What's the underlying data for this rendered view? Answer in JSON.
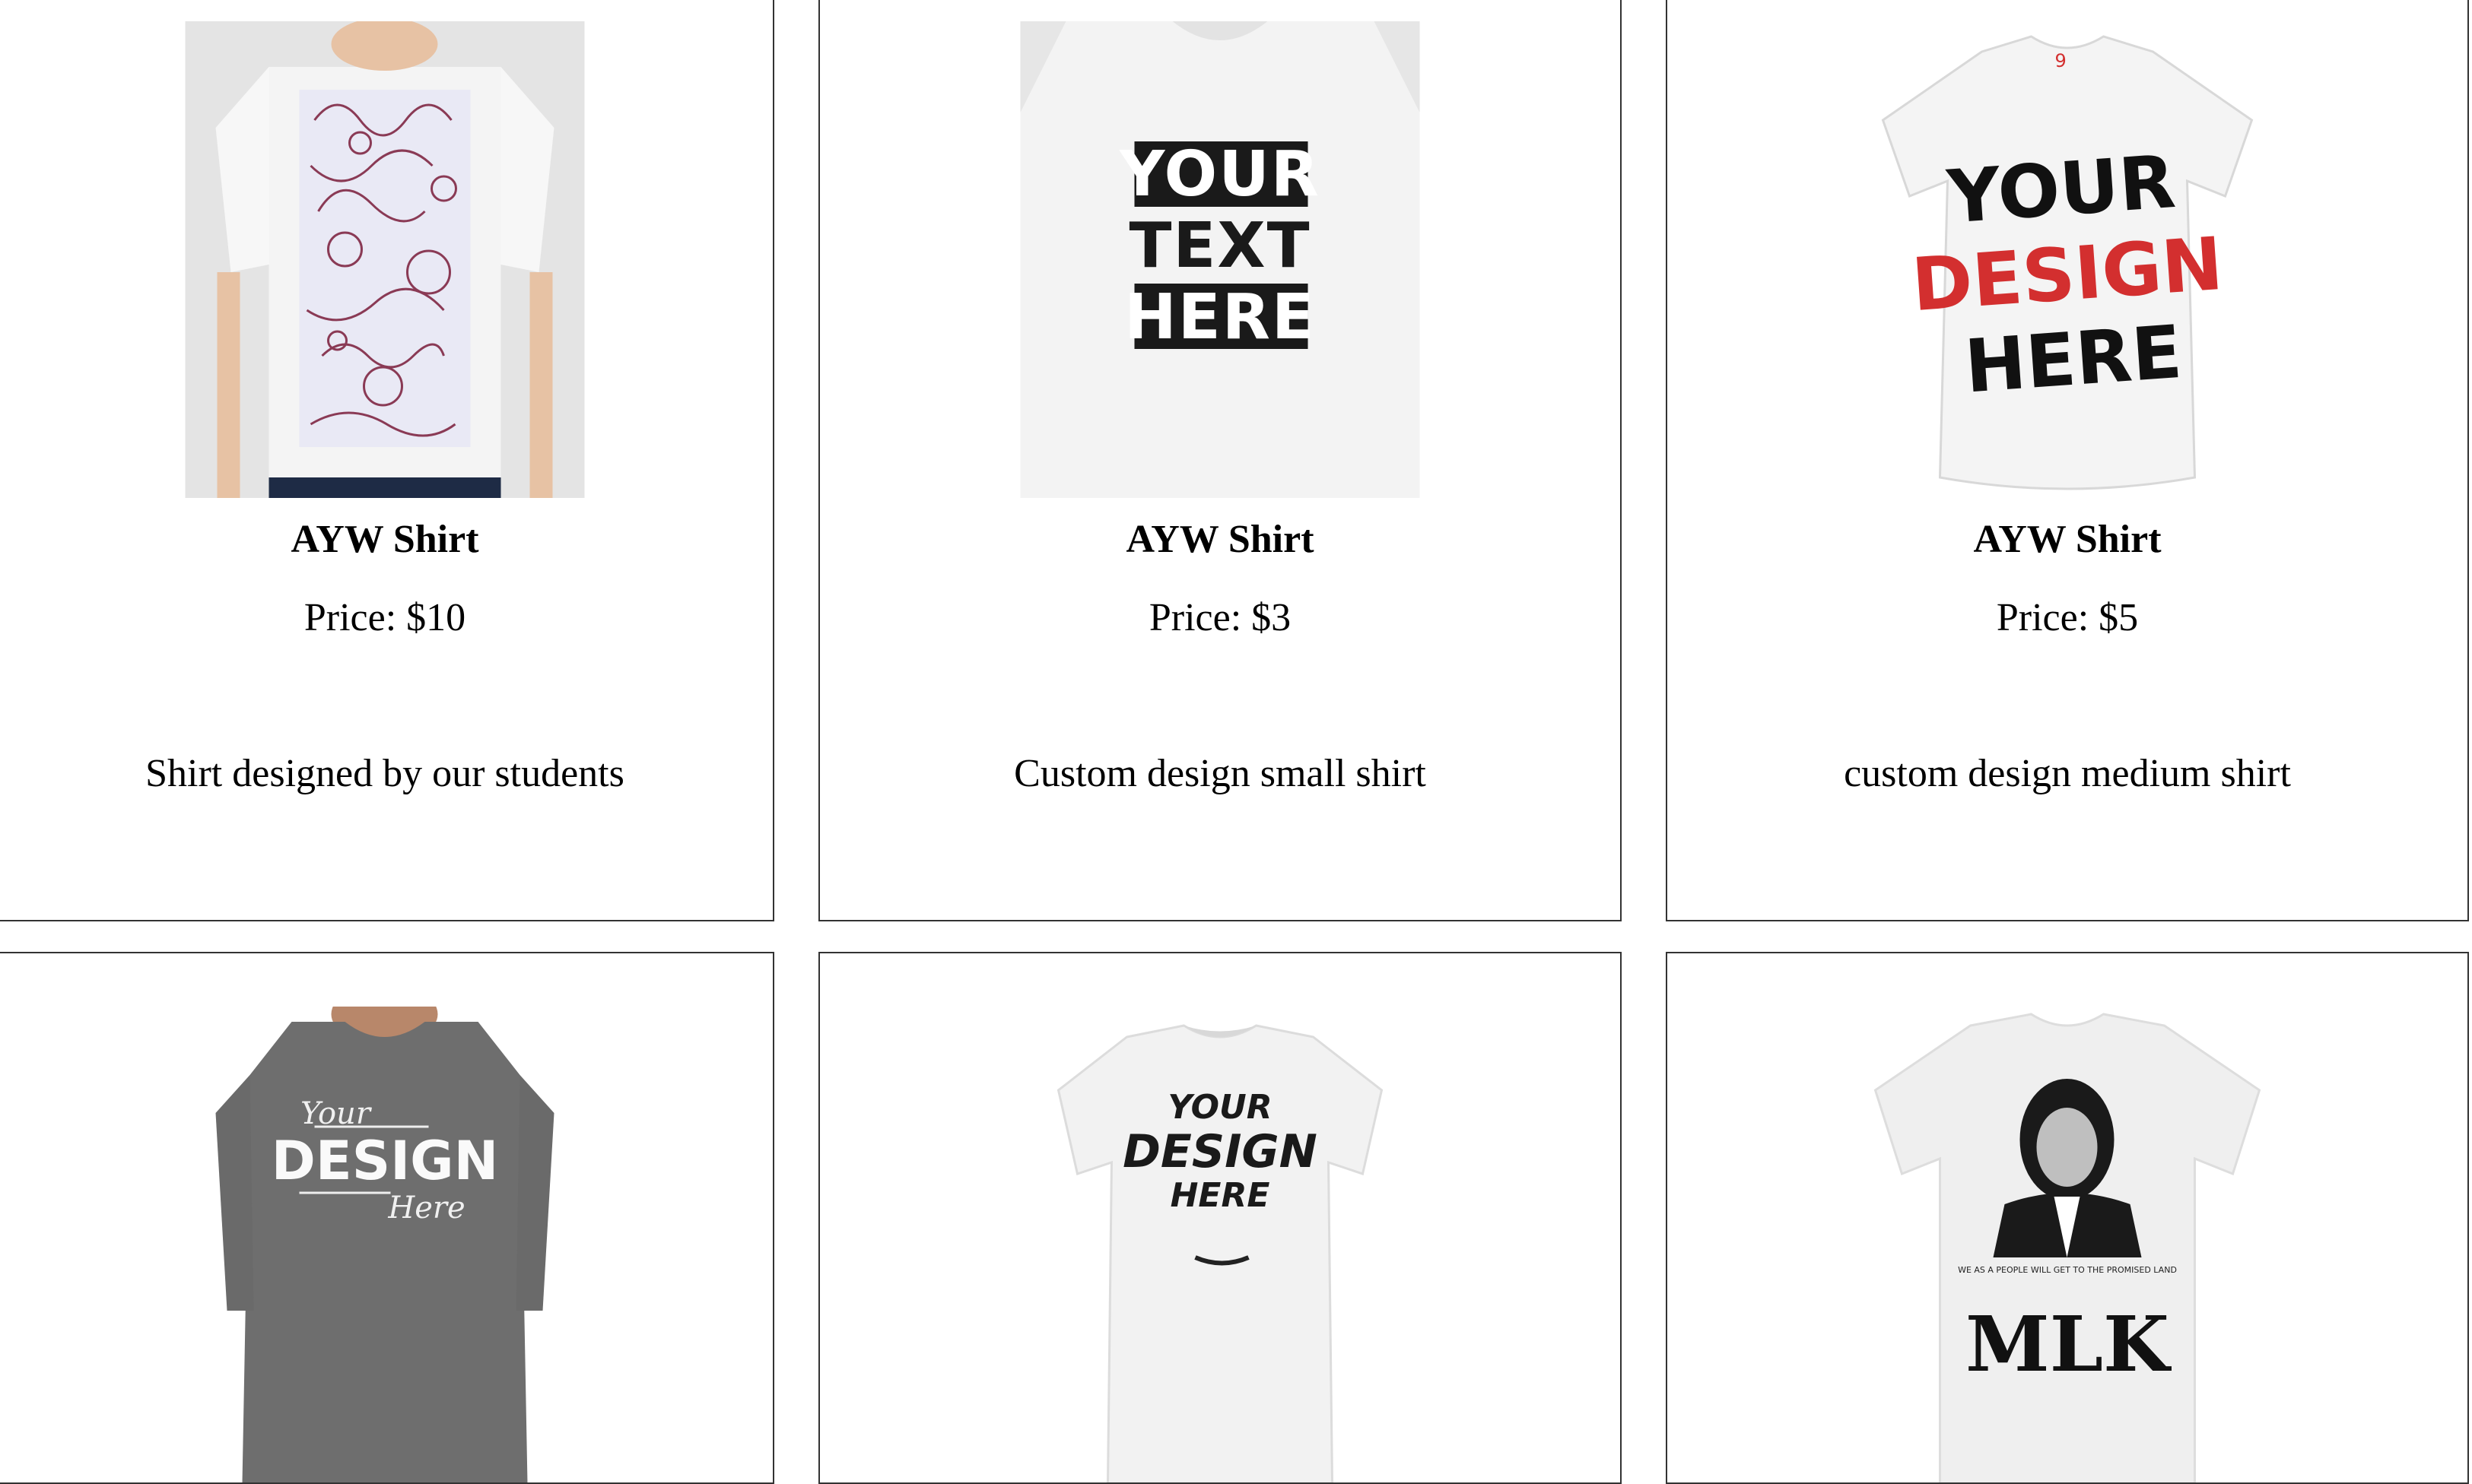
{
  "products": [
    {
      "name": "AYW Shirt",
      "price": "Price: $10",
      "description": "Shirt designed by our students",
      "image_icon": "patterned-white-shirt"
    },
    {
      "name": "AYW Shirt",
      "price": "Price: $3",
      "description": "Custom design small shirt",
      "image_icon": "your-text-here-shirt"
    },
    {
      "name": "AYW Shirt",
      "price": "Price: $5",
      "description": "custom design medium shirt",
      "image_icon": "your-design-here-red-shirt"
    },
    {
      "name": "",
      "price": "",
      "description": "",
      "image_icon": "gray-your-design-here-shirt"
    },
    {
      "name": "",
      "price": "",
      "description": "",
      "image_icon": "white-your-design-here-shirt"
    },
    {
      "name": "",
      "price": "",
      "description": "",
      "image_icon": "mlk-shirt"
    }
  ],
  "shirt_prints": {
    "p2": [
      "YOUR",
      "TEXT",
      "HERE"
    ],
    "p3": [
      "YOUR",
      "DESIGN",
      "HERE"
    ],
    "p4": {
      "script_top": "Your",
      "main": "DESIGN",
      "script_bottom": "Here"
    },
    "p5": [
      "YOUR",
      "DESIGN",
      "HERE"
    ],
    "p6": {
      "caption": "WE AS A PEOPLE WILL GET TO THE PROMISED LAND",
      "main": "MLK"
    }
  },
  "colors": {
    "border": "#333333",
    "photo_bg": "#e6e6e6",
    "accent_red": "#d32f2f",
    "gray_shirt": "#6e6e6e"
  }
}
